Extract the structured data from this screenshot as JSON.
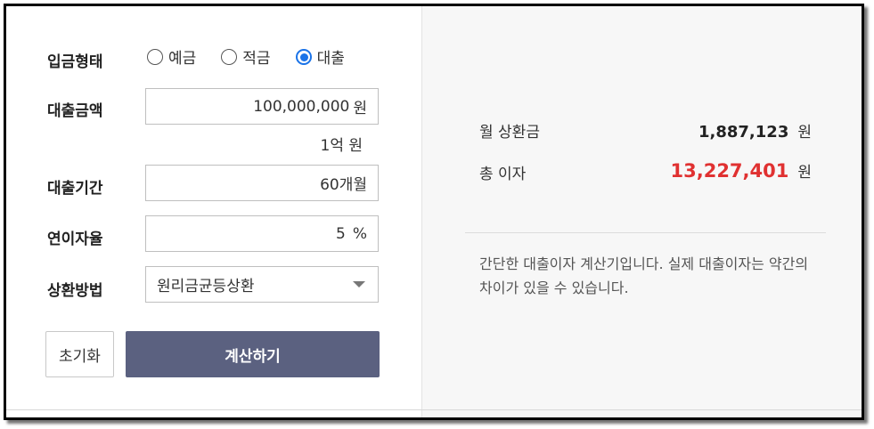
{
  "form": {
    "type_label": "입금형태",
    "radios": [
      {
        "label": "예금",
        "checked": false
      },
      {
        "label": "적금",
        "checked": false
      },
      {
        "label": "대출",
        "checked": true
      }
    ],
    "amount_label": "대출금액",
    "amount_value": "100,000,000",
    "amount_unit": "원",
    "amount_note": "1억 원",
    "period_label": "대출기간",
    "period_value": "60개월",
    "rate_label": "연이자율",
    "rate_value": "5",
    "rate_unit": "%",
    "method_label": "상환방법",
    "method_value": "원리금균등상환",
    "reset_label": "초기화",
    "calc_label": "계산하기"
  },
  "result": {
    "monthly_label": "월 상환금",
    "monthly_value": "1,887,123",
    "interest_label": "총 이자",
    "interest_value": "13,227,401",
    "unit": "원",
    "note": "간단한 대출이자 계산기입니다. 실제 대출이자는 약간의 차이가 있을 수 있습니다."
  },
  "colors": {
    "accent": "#5b6180",
    "radio": "#1a73e8",
    "highlight": "#e03131"
  }
}
